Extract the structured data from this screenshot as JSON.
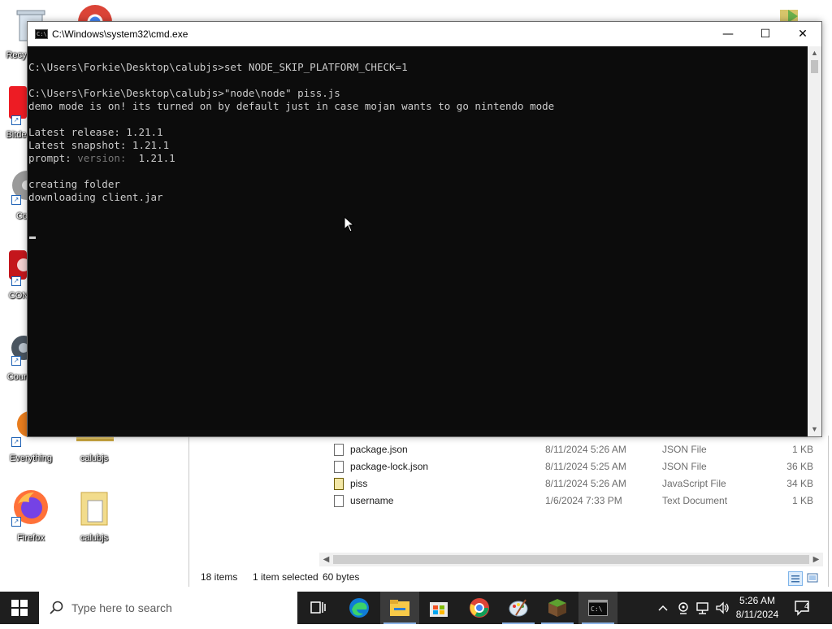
{
  "desktop": {
    "icons": [
      {
        "id": "recycle-bin",
        "label": "Recy"
      },
      {
        "id": "bitdefender",
        "label": "Bitde"
      },
      {
        "id": "app-3",
        "label": "Co"
      },
      {
        "id": "app-4",
        "label": "CON"
      },
      {
        "id": "app-5",
        "label": "Coun"
      },
      {
        "id": "everything",
        "label": "Everything"
      },
      {
        "id": "calubjs-1",
        "label": "calubjs"
      },
      {
        "id": "firefox",
        "label": "Firefox"
      },
      {
        "id": "calubjs-2",
        "label": "calubjs"
      }
    ]
  },
  "cmd": {
    "title": "C:\\Windows\\system32\\cmd.exe",
    "minimize_symbol": "—",
    "maximize_symbol": "☐",
    "close_symbol": "✕",
    "lines": [
      "C:\\Users\\Forkie\\Desktop\\calubjs>set NODE_SKIP_PLATFORM_CHECK=1",
      "",
      "C:\\Users\\Forkie\\Desktop\\calubjs>\"node\\node\" piss.js",
      "demo mode is on! its turned on by default just in case mojan wants to go nintendo mode",
      "",
      "Latest release: 1.21.1",
      "Latest snapshot: 1.21.1",
      "",
      "",
      "creating folder",
      "downloading client.jar"
    ],
    "prompt_line": {
      "prefix": "prompt: ",
      "dim": "version: ",
      "value": " 1.21.1"
    }
  },
  "explorer": {
    "files": [
      {
        "name": "package.json",
        "date": "8/11/2024 5:26 AM",
        "type": "JSON File",
        "size": "1 KB",
        "icon": "json-file-icon"
      },
      {
        "name": "package-lock.json",
        "date": "8/11/2024 5:25 AM",
        "type": "JSON File",
        "size": "36 KB",
        "icon": "json-file-icon"
      },
      {
        "name": "piss",
        "date": "8/11/2024 5:26 AM",
        "type": "JavaScript File",
        "size": "34 KB",
        "icon": "javascript-file-icon"
      },
      {
        "name": "username",
        "date": "1/6/2024 7:33 PM",
        "type": "Text Document",
        "size": "1 KB",
        "icon": "text-file-icon"
      }
    ],
    "status": {
      "items": "18 items",
      "selected": "1 item selected",
      "bytes": "60 bytes"
    }
  },
  "taskbar": {
    "search_placeholder": "Type here to search",
    "time": "5:26 AM",
    "date": "8/11/2024",
    "notification_count": "4",
    "apps": [
      "task-view",
      "edge",
      "file-explorer",
      "microsoft-store",
      "chrome",
      "paint",
      "minecraft",
      "cmd"
    ]
  },
  "colors": {
    "console_bg": "#0c0c0c",
    "console_text": "#cccccc",
    "taskbar_bg": "#1e1e1e"
  }
}
